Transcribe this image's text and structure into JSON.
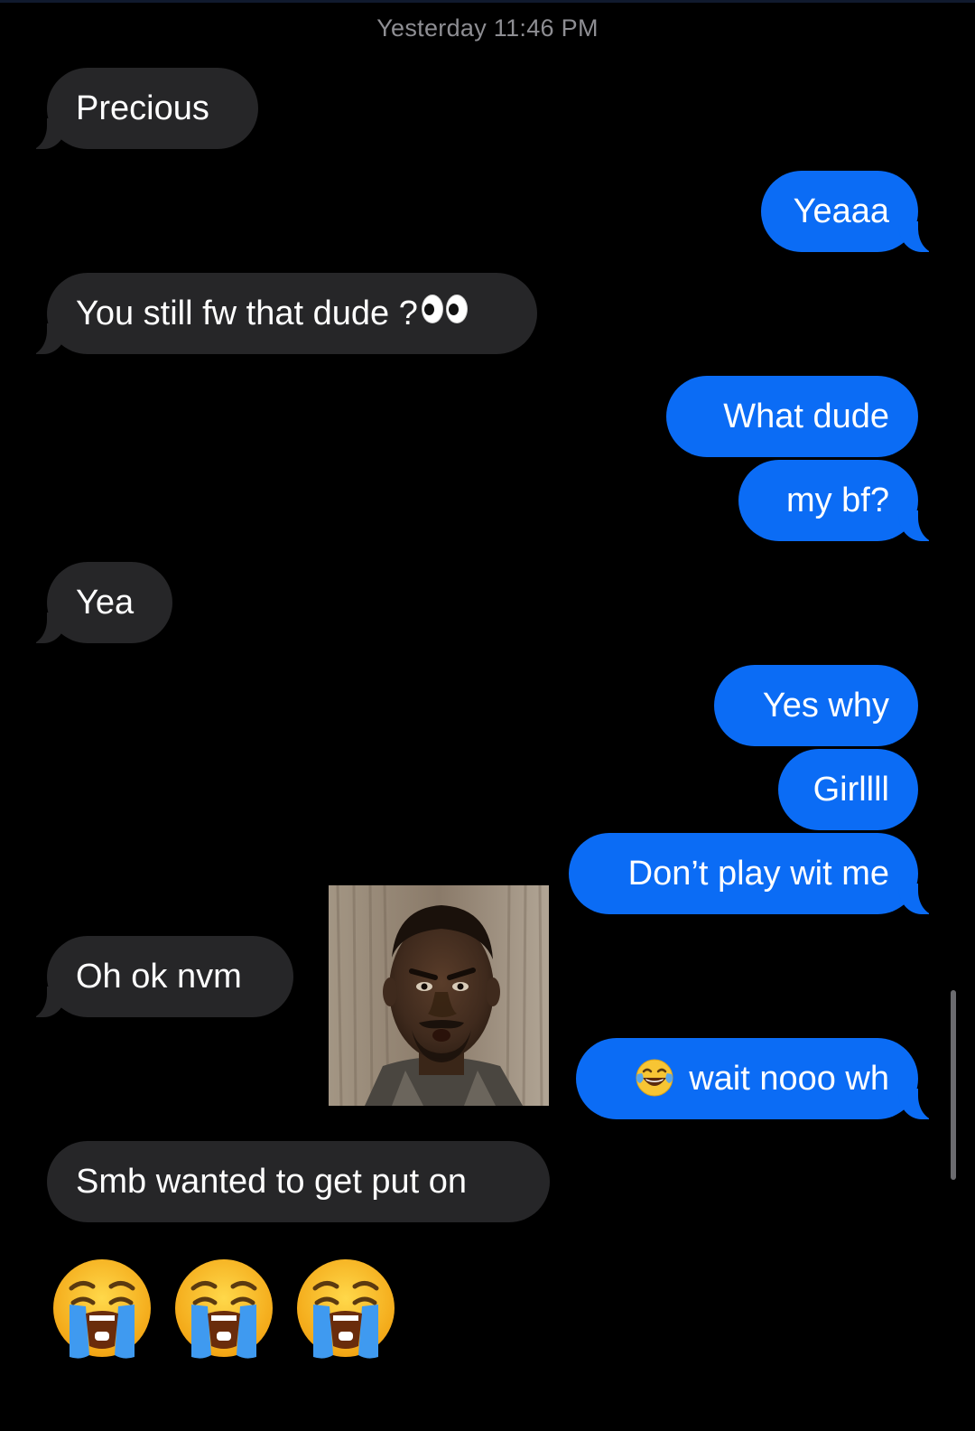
{
  "thread": {
    "timestamp": "Yesterday 11:46 PM"
  },
  "messages": [
    {
      "sender": "them",
      "text": "Precious"
    },
    {
      "sender": "me",
      "text": "Yeaaa"
    },
    {
      "sender": "them",
      "text": "You still fw that dude ?",
      "emoji": "eyes-emoji"
    },
    {
      "sender": "me",
      "text": "What dude"
    },
    {
      "sender": "me",
      "text": "my bf?"
    },
    {
      "sender": "them",
      "text": "Yea"
    },
    {
      "sender": "me",
      "text": "Yes why"
    },
    {
      "sender": "me",
      "text": "Girllll"
    },
    {
      "sender": "me",
      "text": "Don’t play wit me"
    },
    {
      "sender": "them",
      "text": "Oh ok nvm"
    },
    {
      "sender": "them",
      "type": "gif",
      "icon": "reaction-gif-image"
    },
    {
      "sender": "me",
      "text": "wait nooo wh",
      "emoji": "face-with-tears-of-joy-emoji"
    },
    {
      "sender": "them",
      "text": "Smb wanted to get put on"
    },
    {
      "sender": "them",
      "type": "emoji-only",
      "emoji": [
        "loudly-crying-face-emoji",
        "loudly-crying-face-emoji",
        "loudly-crying-face-emoji"
      ]
    }
  ],
  "colors": {
    "background": "#000000",
    "incoming_bubble": "#262628",
    "outgoing_bubble": "#0b6cf5",
    "timestamp_text": "#8e8e93"
  }
}
